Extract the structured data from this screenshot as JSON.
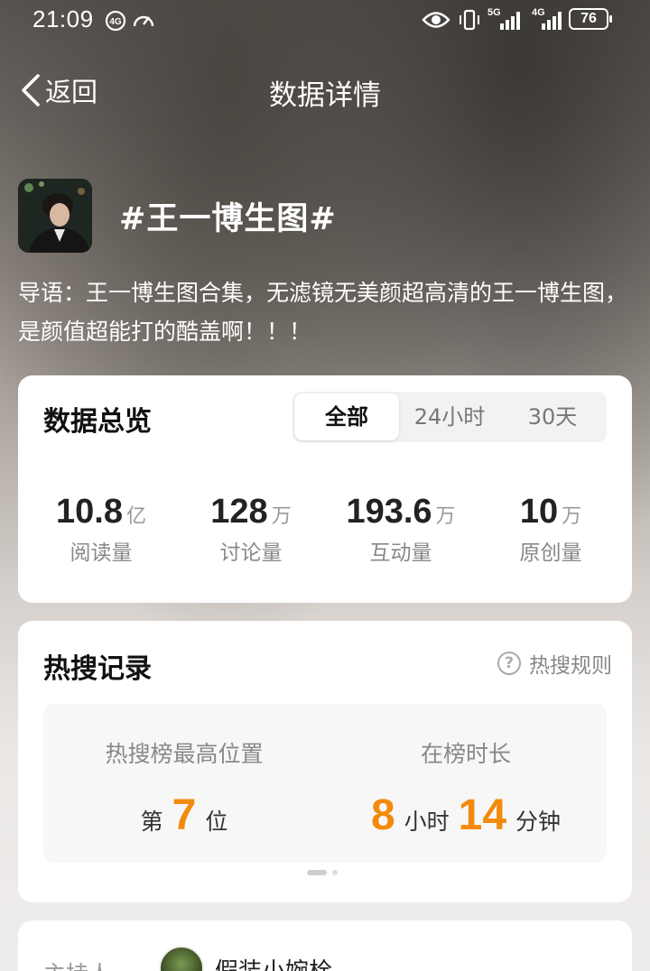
{
  "status_bar": {
    "time": "21:09",
    "battery": "76",
    "net1": "5G",
    "net2": "4G",
    "icons": [
      "hd-icon",
      "speedometer-icon",
      "eye-icon",
      "vibrate-icon",
      "signal-icon",
      "signal-icon",
      "battery-icon"
    ]
  },
  "nav": {
    "back_label": "返回",
    "title": "数据详情"
  },
  "topic": {
    "title": "#王一博生图#",
    "intro": "导语：王一博生图合集，无滤镜无美颜超高清的王一博生图，是颜值超能打的酷盖啊！！！"
  },
  "overview": {
    "title": "数据总览",
    "tabs": [
      "全部",
      "24小时",
      "30天"
    ],
    "active_tab": "全部",
    "stats": [
      {
        "value": "10.8",
        "unit": "亿",
        "label": "阅读量"
      },
      {
        "value": "128",
        "unit": "万",
        "label": "讨论量"
      },
      {
        "value": "193.6",
        "unit": "万",
        "label": "互动量"
      },
      {
        "value": "10",
        "unit": "万",
        "label": "原创量"
      }
    ]
  },
  "hot_search": {
    "title": "热搜记录",
    "rule_label": "热搜规则",
    "peak_label": "热搜榜最高位置",
    "peak_prefix": "第",
    "peak_value": "7",
    "peak_suffix": "位",
    "duration_label": "在榜时长",
    "duration_hours": "8",
    "hours_unit": "小时",
    "duration_minutes": "14",
    "minutes_unit": "分钟"
  },
  "host": {
    "label": "主持人",
    "name": "假装小婉栓"
  },
  "colors": {
    "accent_orange": "#f28a0c",
    "card_bg": "#ffffff"
  }
}
